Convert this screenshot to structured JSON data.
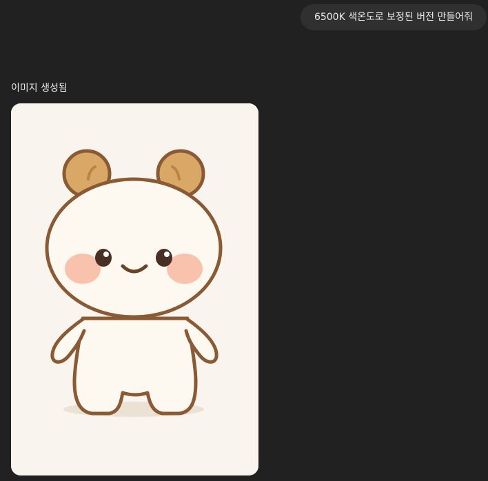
{
  "user_message": {
    "text": "6500K 색온도로 보정된 버전 만들어줘"
  },
  "assistant": {
    "status": "이미지 생성됨",
    "image": {
      "subject": "cute-bear-character-icon",
      "colors": {
        "background": "#f9f5ee",
        "outline": "#8a5a35",
        "ear_fill": "#d9a866",
        "body_fill": "#fdf8f0",
        "cheek": "#f8b9a0",
        "eye": "#4a3024"
      }
    }
  }
}
